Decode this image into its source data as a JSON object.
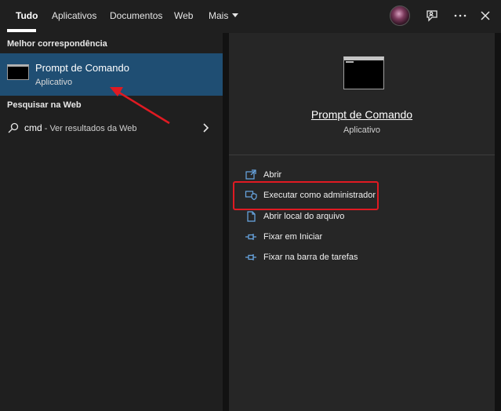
{
  "tabs": [
    {
      "label": "Tudo",
      "active": true
    },
    {
      "label": "Aplicativos"
    },
    {
      "label": "Documentos"
    },
    {
      "label": "Web"
    },
    {
      "label": "Mais"
    }
  ],
  "top_icons": [
    "avatar",
    "feedback-icon",
    "more-options-icon",
    "close-icon"
  ],
  "left": {
    "best_match_header": "Melhor correspondência",
    "best_match": {
      "title": "Prompt de Comando",
      "subtitle": "Aplicativo",
      "icon": "terminal-icon"
    },
    "web_header": "Pesquisar na Web",
    "web_result": {
      "term": "cmd",
      "rest": " - Ver resultados da Web",
      "icon": "search-icon"
    }
  },
  "detail": {
    "title": "Prompt de Comando",
    "subtitle": "Aplicativo",
    "actions": [
      {
        "label": "Abrir",
        "icon": "open-icon"
      },
      {
        "label": "Executar como administrador",
        "icon": "shield-icon"
      },
      {
        "label": "Abrir local do arquivo",
        "icon": "file-location-icon"
      },
      {
        "label": "Fixar em Iniciar",
        "icon": "pin-icon"
      },
      {
        "label": "Fixar na barra de tarefas",
        "icon": "pin-icon"
      }
    ]
  },
  "colors": {
    "accent_selected": "#1f4e73",
    "annotation": "#e01a22",
    "background": "#1f1f1f",
    "detail_background": "#262626"
  }
}
